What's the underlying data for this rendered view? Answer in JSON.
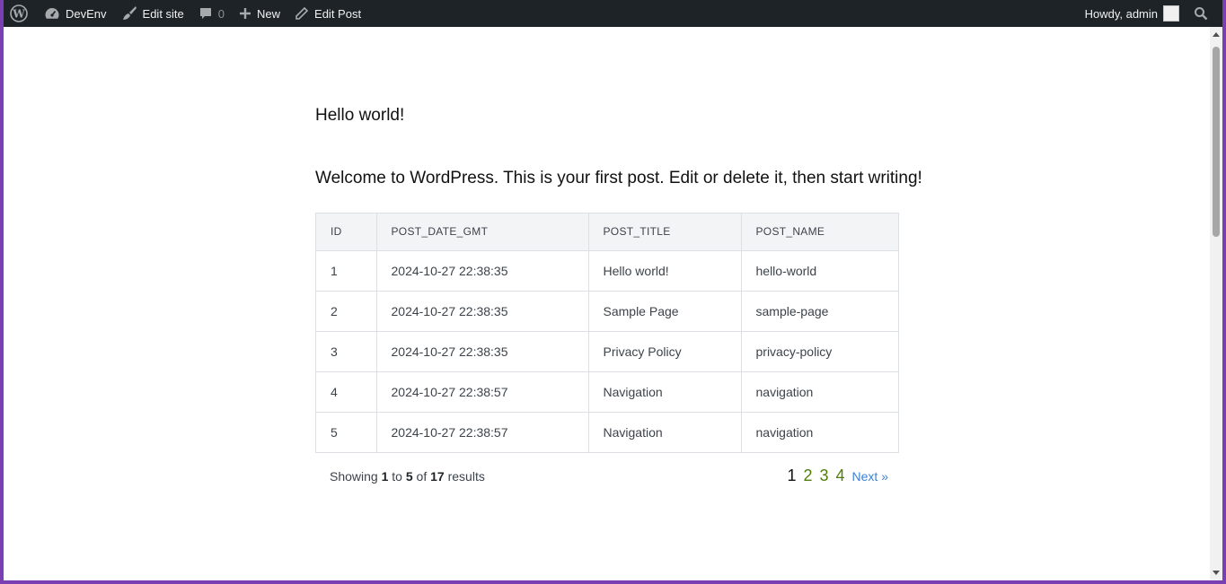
{
  "adminbar": {
    "site_name": "DevEnv",
    "edit_site": "Edit site",
    "comments_count": "0",
    "new_label": "New",
    "edit_post": "Edit Post",
    "howdy": "Howdy, admin"
  },
  "post": {
    "title": "Hello world!",
    "body": "Welcome to WordPress. This is your first post. Edit or delete it, then start writing!"
  },
  "table": {
    "headers": [
      "ID",
      "POST_DATE_GMT",
      "POST_TITLE",
      "POST_NAME"
    ],
    "rows": [
      [
        "1",
        "2024-10-27 22:38:35",
        "Hello world!",
        "hello-world"
      ],
      [
        "2",
        "2024-10-27 22:38:35",
        "Sample Page",
        "sample-page"
      ],
      [
        "3",
        "2024-10-27 22:38:35",
        "Privacy Policy",
        "privacy-policy"
      ],
      [
        "4",
        "2024-10-27 22:38:57",
        "Navigation",
        "navigation"
      ],
      [
        "5",
        "2024-10-27 22:38:57",
        "Navigation",
        "navigation"
      ]
    ]
  },
  "pagination": {
    "showing_prefix": "Showing",
    "from": "1",
    "to_word": "to",
    "to": "5",
    "of_word": "of",
    "total": "17",
    "results_word": "results",
    "pages": [
      "1",
      "2",
      "3",
      "4"
    ],
    "current_page": "1",
    "next_label": "Next »"
  },
  "colors": {
    "adminbar_bg": "#1d2327",
    "page_link": "#4f7d0a",
    "next_link": "#3b82d6",
    "window_border": "#7b3fb4"
  }
}
